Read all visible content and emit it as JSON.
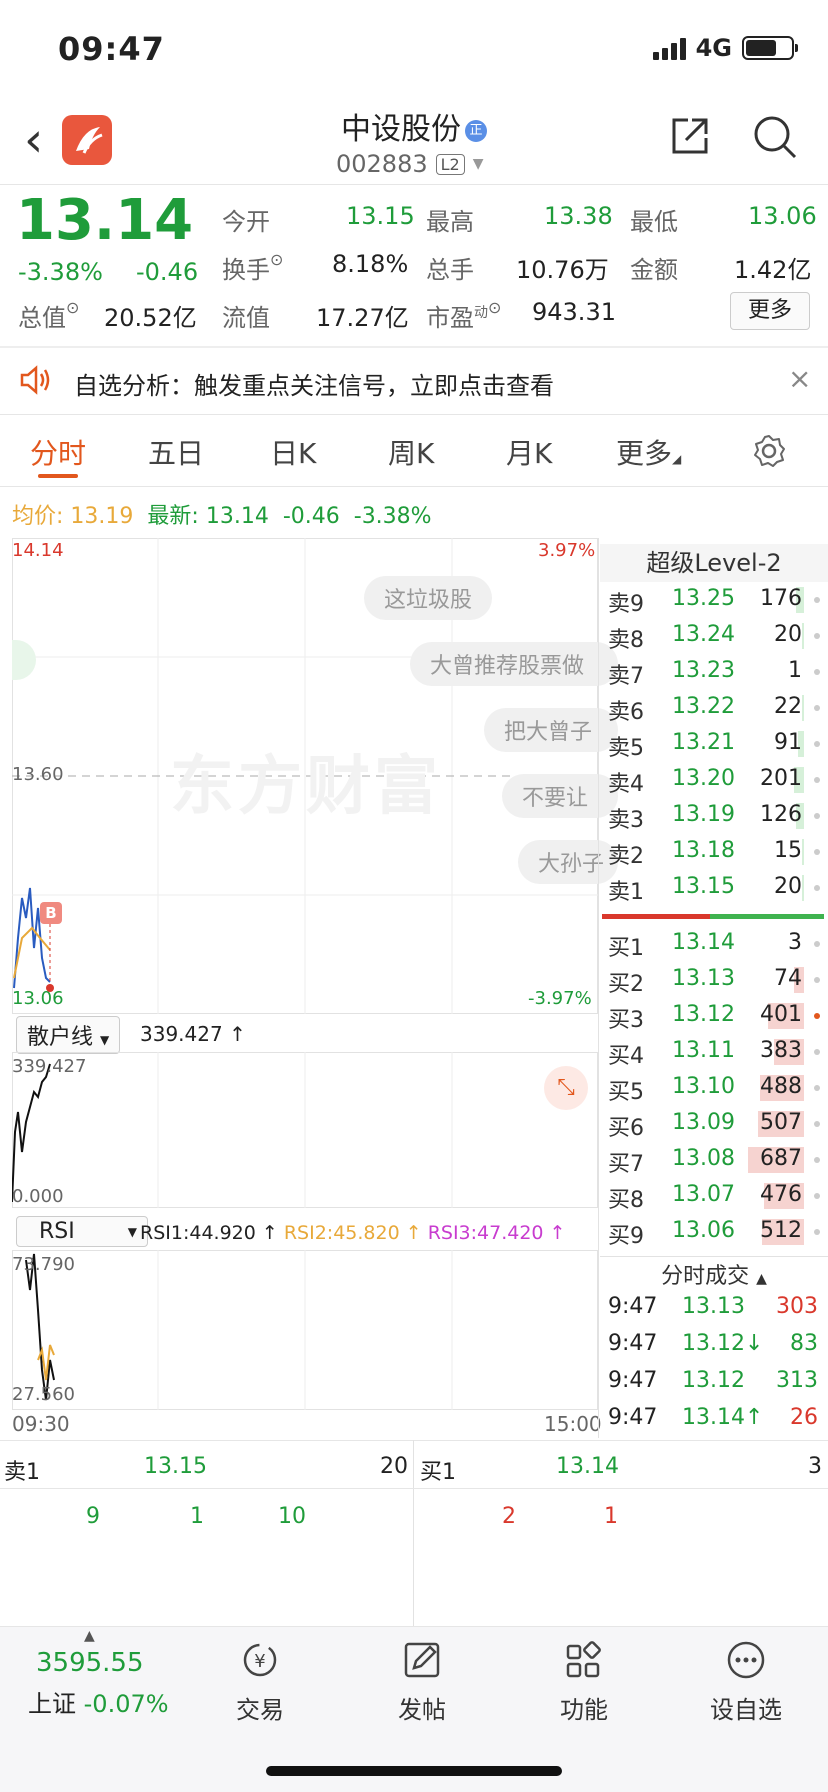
{
  "status": {
    "time": "09:47",
    "network": "4G"
  },
  "header": {
    "title": "中设股份",
    "badge": "正",
    "code": "002883",
    "level_tag": "L2"
  },
  "quote": {
    "price": "13.14",
    "change_pct": "-3.38%",
    "change": "-0.46",
    "open_label": "今开",
    "open": "13.15",
    "high_label": "最高",
    "high": "13.38",
    "low_label": "最低",
    "low": "13.06",
    "turnover_label": "换手",
    "turnover": "8.18%",
    "volume_label": "总手",
    "volume": "10.76万",
    "amount_label": "金额",
    "amount": "1.42亿",
    "mktcap_label": "总值",
    "mktcap": "20.52亿",
    "float_label": "流值",
    "float": "17.27亿",
    "pe_label": "市盈",
    "pe_sup": "动",
    "pe": "943.31",
    "more_label": "更多"
  },
  "banner": {
    "text": "自选分析：触发重点关注信号，立即点击查看"
  },
  "tabs": [
    "分时",
    "五日",
    "日K",
    "周K",
    "月K",
    "更多"
  ],
  "avg": {
    "avg_label": "均价:",
    "avg": "13.19",
    "latest_label": "最新:",
    "latest": "13.14",
    "chg": "-0.46",
    "pct": "-3.38%"
  },
  "chart": {
    "top_price": "14.14",
    "top_pct": "3.97%",
    "mid_price": "13.60",
    "bottom_price": "13.06",
    "bottom_pct": "-3.97%",
    "watermark": "东方财富",
    "marker": "B",
    "bubbles": [
      "这垃圾股",
      "大曾推荐股票做",
      "把大曾子",
      "不要让",
      "大孙子"
    ]
  },
  "retail": {
    "label": "散户线",
    "value": "339.427 ↑",
    "max": "339.427",
    "min": "0.000"
  },
  "rsi": {
    "label": "RSI",
    "rsi1": "RSI1:44.920 ↑",
    "rsi2": "RSI2:45.820 ↑",
    "rsi3": "RSI3:47.420 ↑",
    "max": "73.790",
    "min": "27.560",
    "start_time": "09:30",
    "end_time": "15:00"
  },
  "orderbook": {
    "title": "超级Level-2",
    "sells": [
      {
        "label": "卖9",
        "price": "13.25",
        "vol": "176"
      },
      {
        "label": "卖8",
        "price": "13.24",
        "vol": "20"
      },
      {
        "label": "卖7",
        "price": "13.23",
        "vol": "1"
      },
      {
        "label": "卖6",
        "price": "13.22",
        "vol": "22"
      },
      {
        "label": "卖5",
        "price": "13.21",
        "vol": "91"
      },
      {
        "label": "卖4",
        "price": "13.20",
        "vol": "201"
      },
      {
        "label": "卖3",
        "price": "13.19",
        "vol": "126"
      },
      {
        "label": "卖2",
        "price": "13.18",
        "vol": "15"
      },
      {
        "label": "卖1",
        "price": "13.15",
        "vol": "20"
      }
    ],
    "buys": [
      {
        "label": "买1",
        "price": "13.14",
        "vol": "3"
      },
      {
        "label": "买2",
        "price": "13.13",
        "vol": "74"
      },
      {
        "label": "买3",
        "price": "13.12",
        "vol": "401"
      },
      {
        "label": "买4",
        "price": "13.11",
        "vol": "383"
      },
      {
        "label": "买5",
        "price": "13.10",
        "vol": "488"
      },
      {
        "label": "买6",
        "price": "13.09",
        "vol": "507"
      },
      {
        "label": "买7",
        "price": "13.08",
        "vol": "687"
      },
      {
        "label": "买8",
        "price": "13.07",
        "vol": "476"
      },
      {
        "label": "买9",
        "price": "13.06",
        "vol": "512"
      }
    ]
  },
  "trades": {
    "title": "分时成交",
    "rows": [
      {
        "time": "9:47",
        "price": "13.13",
        "vol": "303"
      },
      {
        "time": "9:47",
        "price": "13.12↓",
        "vol": "83"
      },
      {
        "time": "9:47",
        "price": "13.12",
        "vol": "313"
      },
      {
        "time": "9:47",
        "price": "13.14↑",
        "vol": "26"
      }
    ]
  },
  "bottom_quote": {
    "sell_label": "卖1",
    "sell_price": "13.15",
    "sell_vol": "20",
    "buy_label": "买1",
    "buy_price": "13.14",
    "buy_vol": "3",
    "sell_queue": [
      "9",
      "1",
      "10"
    ],
    "buy_queue": [
      "2",
      "1"
    ]
  },
  "nav": {
    "index_value": "3595.55",
    "index_name": "上证",
    "index_pct": "-0.07%",
    "items": [
      "交易",
      "发帖",
      "功能",
      "设自选"
    ]
  }
}
